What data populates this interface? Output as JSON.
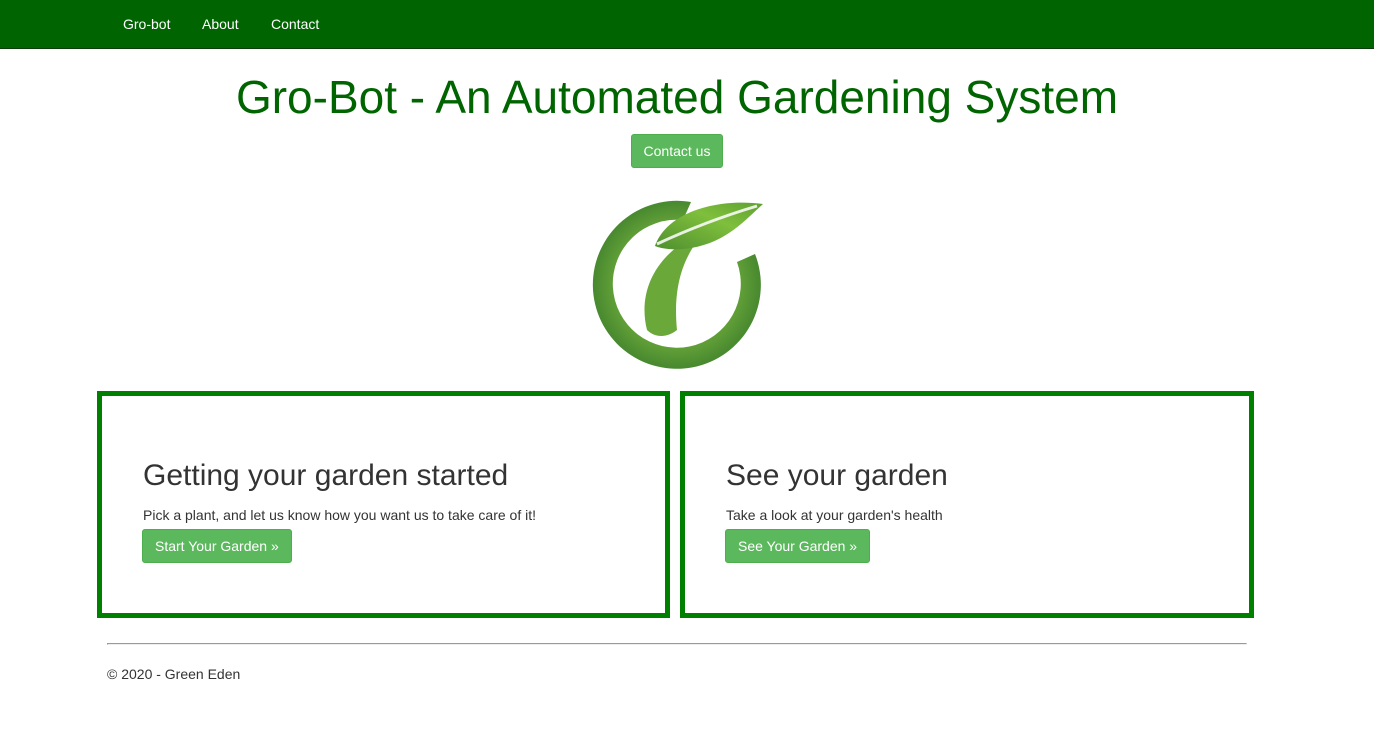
{
  "navbar": {
    "brand": "Gro-bot",
    "links": [
      {
        "label": "About"
      },
      {
        "label": "Contact"
      }
    ]
  },
  "hero": {
    "title": "Gro-Bot - An Automated Gardening System",
    "contact_button": "Contact us",
    "logo_icon": "leaf-logo-icon"
  },
  "cards": [
    {
      "title": "Getting your garden started",
      "text": "Pick a plant, and let us know how you want us to take care of it!",
      "button": "Start Your Garden »"
    },
    {
      "title": "See your garden",
      "text": "Take a look at your garden's health",
      "button": "See Your Garden »"
    }
  ],
  "footer": {
    "copyright": "© 2020 - Green Eden"
  },
  "colors": {
    "navbar_bg": "#006400",
    "title_green": "#006400",
    "button_green": "#5cb85c",
    "card_border": "#008000"
  }
}
